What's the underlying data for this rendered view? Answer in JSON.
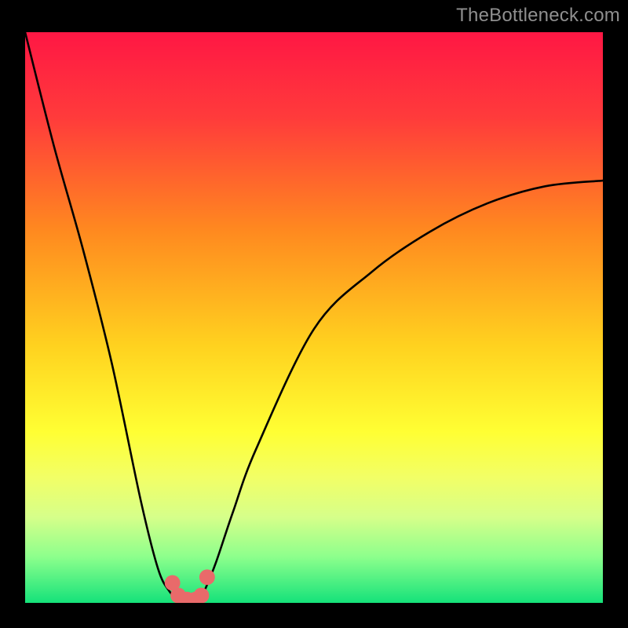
{
  "watermark": "TheBottleneck.com",
  "chart_data": {
    "type": "line",
    "title": "",
    "xlabel": "",
    "ylabel": "",
    "xlim": [
      0,
      100
    ],
    "ylim": [
      0,
      100
    ],
    "gradient_stops": [
      {
        "pct": 0,
        "color": "#ff1744"
      },
      {
        "pct": 15,
        "color": "#ff3b3b"
      },
      {
        "pct": 35,
        "color": "#ff8a1f"
      },
      {
        "pct": 55,
        "color": "#ffd21f"
      },
      {
        "pct": 70,
        "color": "#ffff33"
      },
      {
        "pct": 78,
        "color": "#f2ff66"
      },
      {
        "pct": 85,
        "color": "#d6ff8a"
      },
      {
        "pct": 92,
        "color": "#8cff8c"
      },
      {
        "pct": 100,
        "color": "#15e27a"
      }
    ],
    "series": [
      {
        "name": "bottleneck-curve",
        "x": [
          0,
          5,
          10,
          15,
          20,
          23,
          25,
          27,
          28,
          29,
          30,
          31,
          33,
          36,
          40,
          50,
          60,
          70,
          80,
          90,
          100
        ],
        "y": [
          100,
          80,
          62,
          42,
          18,
          6,
          2,
          0,
          0,
          0,
          0,
          2,
          7,
          16,
          27,
          48,
          58,
          65,
          70,
          73,
          74
        ]
      }
    ],
    "markers": [
      {
        "x": 25.5,
        "y": 3.5
      },
      {
        "x": 26.5,
        "y": 1.3
      },
      {
        "x": 28.0,
        "y": 0.6
      },
      {
        "x": 29.5,
        "y": 0.6
      },
      {
        "x": 30.5,
        "y": 1.3
      },
      {
        "x": 31.5,
        "y": 4.5
      }
    ],
    "marker_color": "#e96a6a",
    "marker_radius_pct": 1.35
  }
}
